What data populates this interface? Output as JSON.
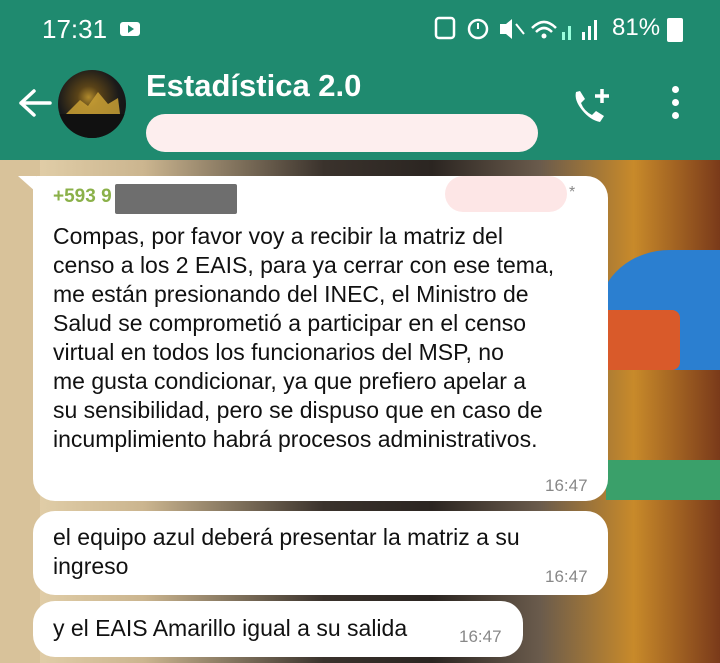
{
  "status_bar": {
    "time": "17:31",
    "battery": "81%",
    "icons": [
      "youtube-icon",
      "rec-icon",
      "alarm-icon",
      "mute-icon",
      "wifi-icon",
      "signal-icon",
      "signal-icon",
      "battery-icon"
    ]
  },
  "header": {
    "title": "Estadística 2.0",
    "actions": [
      "add-call-icon",
      "more-icon"
    ]
  },
  "messages": [
    {
      "sender": "+593 9",
      "text": "Compas, por favor voy a recibir la matriz del\ncenso a los 2 EAIS, para ya cerrar con ese tema,\nme están presionando del INEC, el Ministro de\nSalud se comprometió a participar en el censo\nvirtual en todos los funcionarios del MSP, no\nme gusta condicionar, ya que prefiero apelar a\nsu sensibilidad, pero se dispuso que en caso de\nincumplimiento habrá procesos administrativos.",
      "time": "16:47",
      "marker": "*"
    },
    {
      "text": "el equipo azul deberá presentar la matriz a su\ningreso",
      "time": "16:47"
    },
    {
      "text": "y el EAIS Amarillo igual a su salida",
      "time": "16:47"
    }
  ],
  "colors": {
    "header": "#1f8a6f",
    "sender": "#8bb14a",
    "bubble": "#ffffff"
  }
}
